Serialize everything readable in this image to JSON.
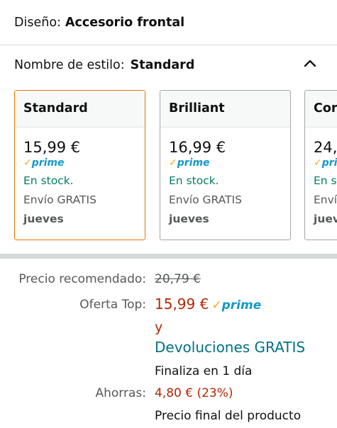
{
  "design": {
    "label": "Diseño:",
    "value": "Accesorio frontal"
  },
  "style": {
    "label": "Nombre de estilo:",
    "value": "Standard"
  },
  "prime_check": "✓",
  "prime_word": "prime",
  "cards": [
    {
      "name": "Standard",
      "price": "15,99 €",
      "stock": "En stock.",
      "shipping": "Envío GRATIS",
      "day": "jueves",
      "selected": true
    },
    {
      "name": "Brilliant",
      "price": "16,99 €",
      "stock": "En stock.",
      "shipping": "Envío GRATIS",
      "day": "jueves",
      "selected": false
    },
    {
      "name": "Cor",
      "price": "24,",
      "stock": "En st",
      "shipping": "Enví",
      "day": "juev",
      "selected": false
    }
  ],
  "pricing": {
    "recommended_label": "Precio recomendado:",
    "recommended_value": "20,79 €",
    "offer_label": "Oferta Top:",
    "offer_value": "15,99 €",
    "and": "y",
    "returns": "Devoluciones GRATIS",
    "ends": "Finaliza en 1 día",
    "savings_label": "Ahorras:",
    "savings_value": "4,80 € (23%)",
    "final": "Precio final del producto"
  },
  "colors": {
    "accent_orange": "#e77600",
    "in_stock_green": "#067d62",
    "price_red": "#b12704",
    "link_teal": "#007185",
    "prime_blue": "#1399c6"
  }
}
